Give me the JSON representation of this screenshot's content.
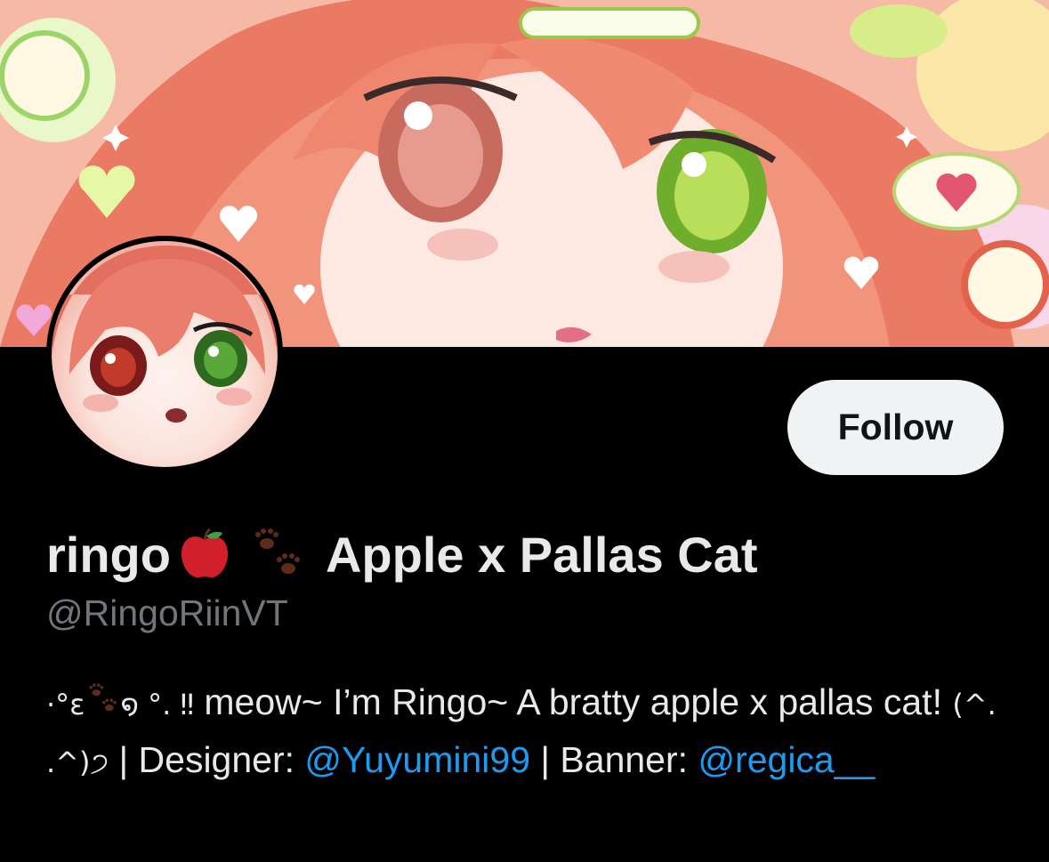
{
  "profile": {
    "display_name_text": "ringo",
    "display_name_suffix": "Apple x Pallas Cat",
    "emojis": [
      "apple-emoji",
      "paw-prints-emoji"
    ],
    "handle": "@RingoRiinVT",
    "follow_label": "Follow",
    "bio": {
      "lead_kaomoji": "·°ɛ",
      "lead_kaomoji_end": "໑ °. ‼",
      "text_1": " meow~ I’m Ringo~ A bratty apple x pallas cat! ",
      "kaomoji_2": "(^. .^)੭",
      "text_2": " | Designer: ",
      "designer_link": "@Yuyumini99",
      "text_3": " | Banner: ",
      "banner_link": "@regica__"
    }
  },
  "colors": {
    "background": "#000000",
    "follow_bg": "#eff3f4",
    "link": "#1d9bf0",
    "handle": "#71767b",
    "text": "#e7e9ea"
  }
}
